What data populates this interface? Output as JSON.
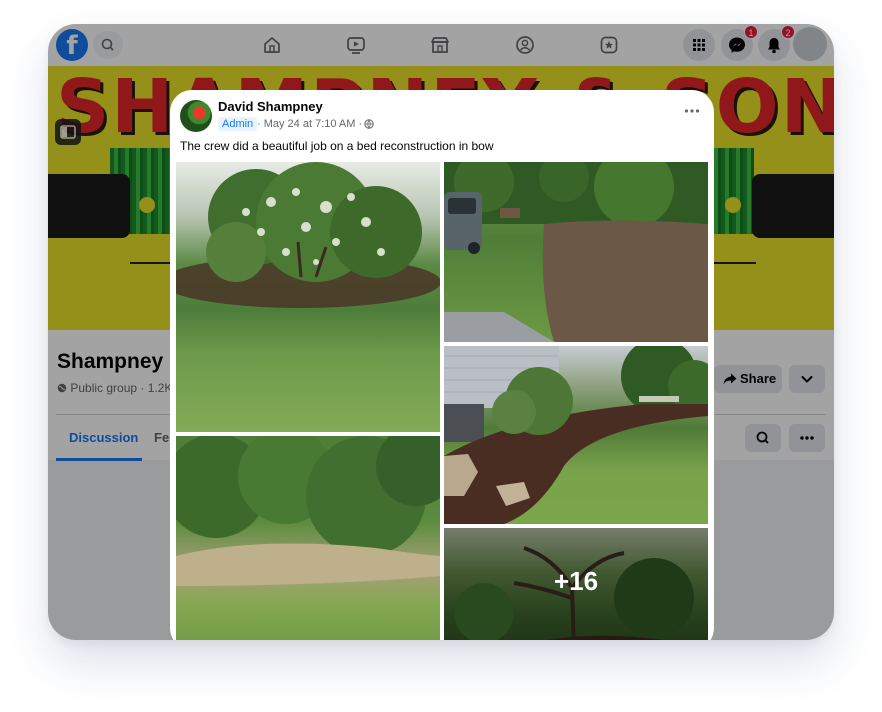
{
  "top_nav": {
    "messenger_badge": "1",
    "notifications_badge": "2"
  },
  "cover": {
    "text": "SHAMPNEY & SONS"
  },
  "group": {
    "name": "Shampney",
    "meta": "Public group · 1.2K",
    "share_label": "Share",
    "tabs": [
      {
        "label": "Discussion",
        "active": true
      },
      {
        "label": "Fe",
        "active": false
      }
    ]
  },
  "post": {
    "author": "David Shampney",
    "role_badge": "Admin",
    "date": "· May 24 at 7:10 AM ·",
    "text": "The crew did a beautiful job on a bed reconstruction in bow",
    "more_photos": "+16"
  },
  "colors": {
    "facebook_blue": "#1877f2",
    "badge_red": "#e41e3f",
    "cover_yellow": "#e9e12a",
    "cover_red": "#e3262a"
  }
}
